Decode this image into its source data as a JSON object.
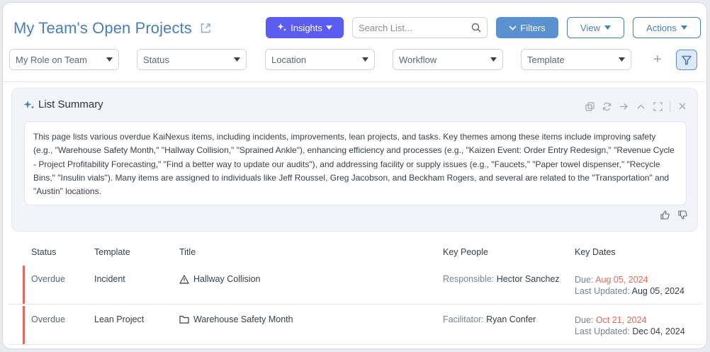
{
  "header": {
    "title": "My Team's Open Projects",
    "insights_label": "Insights",
    "search_placeholder": "Search List...",
    "filters_label": "Filters",
    "view_label": "View",
    "actions_label": "Actions"
  },
  "filters": {
    "role": "My Role on Team",
    "status": "Status",
    "location": "Location",
    "workflow": "Workflow",
    "template": "Template",
    "add": "+"
  },
  "summary": {
    "title": "List Summary",
    "text": "This page lists various overdue KaiNexus items, including incidents, improvements, lean projects, and tasks. Key themes among these items include improving safety (e.g., \"Warehouse Safety Month,\" \"Hallway Collision,\" \"Sprained Ankle\"), enhancing efficiency and processes (e.g., \"Kaizen Event: Order Entry Redesign,\" \"Revenue Cycle - Project Profitability Forecasting,\" \"Find a better way to update our audits\"), and addressing facility or supply issues (e.g., \"Faucets,\" \"Paper towel dispenser,\" \"Recycle Bins,\" \"Insulin vials\"). Many items are assigned to individuals like Jeff Roussel, Greg Jacobson, and Beckham Rogers, and several are related to the \"Transportation\" and \"Austin\" locations."
  },
  "table": {
    "columns": {
      "status": "Status",
      "template": "Template",
      "title": "Title",
      "people": "Key People",
      "dates": "Key Dates"
    },
    "rows": [
      {
        "status": "Overdue",
        "template": "Incident",
        "icon": "warning-icon",
        "title": "Hallway Collision",
        "people_role": "Responsible:",
        "people_name": "Hector Sanchez",
        "due_label": "Due:",
        "due_date": "Aug 05, 2024",
        "updated_label": "Last Updated:",
        "updated_date": "Aug 05, 2024"
      },
      {
        "status": "Overdue",
        "template": "Lean Project",
        "icon": "folder-icon",
        "title": "Warehouse Safety Month",
        "people_role": "Facilitator:",
        "people_name": "Ryan Confer",
        "due_label": "Due:",
        "due_date": "Oct 21, 2024",
        "updated_label": "Last Updated:",
        "updated_date": "Dec 04, 2024"
      }
    ]
  },
  "colors": {
    "accent": "#4a7fb5",
    "insights": "#5b5cf0",
    "overdue": "#e06b5a"
  }
}
